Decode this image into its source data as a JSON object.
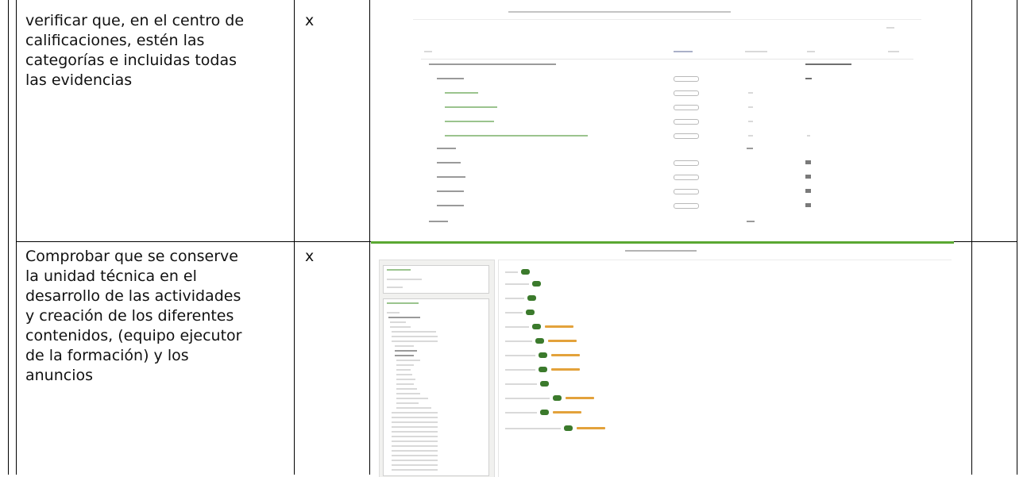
{
  "rows": [
    {
      "description_lines": [
        "verificar que, en el centro de",
        "calificaciones, estén las",
        "categorías e incluidas todas",
        "las evidencias"
      ],
      "mark": "x"
    },
    {
      "description_lines": [
        "Comprobar que se conserve",
        "la unidad técnica en el",
        "desarrollo de las actividades",
        "y creación de los diferentes",
        "contenidos, (equipo ejecutor",
        "de la formación) y los",
        "anuncios"
      ],
      "mark": "x"
    }
  ],
  "colors": {
    "grid": "#000000",
    "screenshot_border": "#c8c8c8",
    "accent_green": "#3b7a2c",
    "accent_orange": "#e3a23b"
  }
}
